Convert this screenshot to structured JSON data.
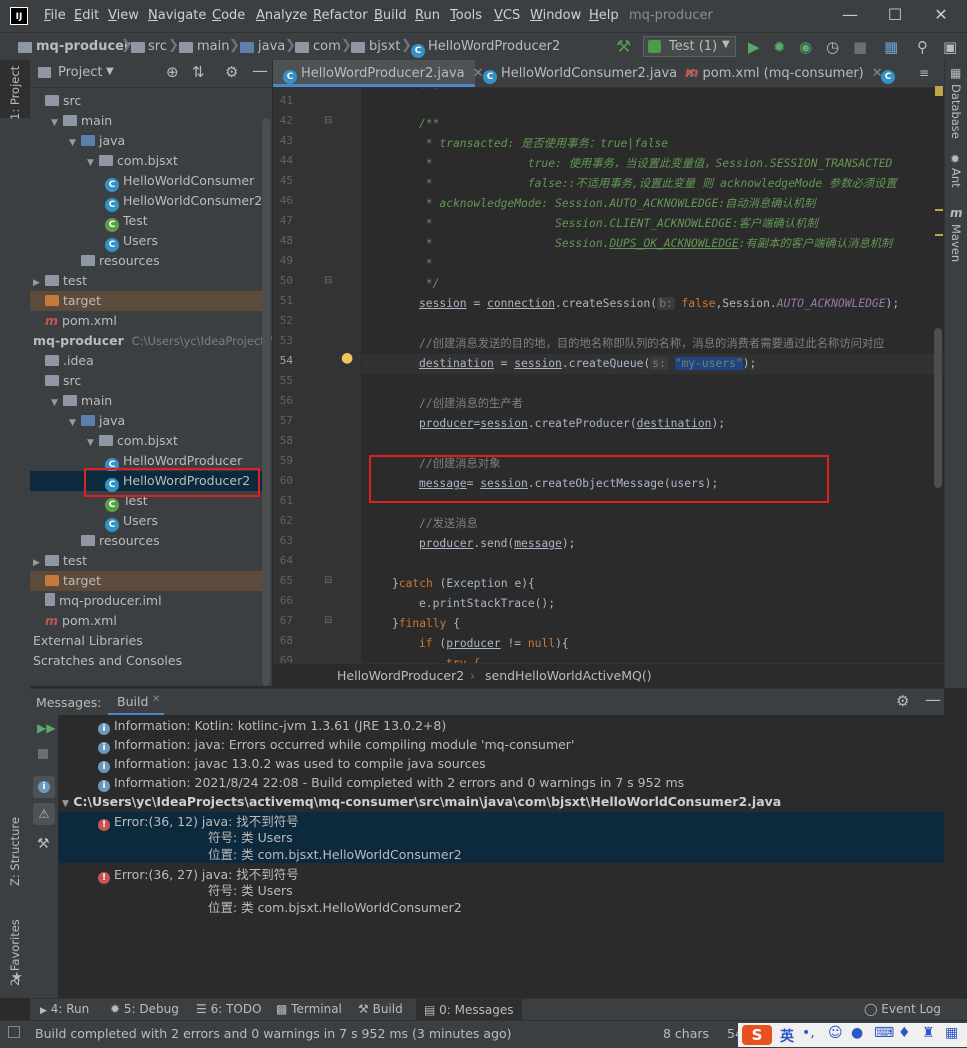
{
  "app": {
    "title": "mq-producer",
    "menu": [
      "File",
      "Edit",
      "View",
      "Navigate",
      "Code",
      "Analyze",
      "Refactor",
      "Build",
      "Run",
      "Tools",
      "VCS",
      "Window",
      "Help"
    ]
  },
  "nav": {
    "crumbs": [
      "mq-producer",
      "src",
      "main",
      "java",
      "com",
      "bjsxt",
      "HelloWordProducer2"
    ],
    "run_config": "Test (1)"
  },
  "left_stripe": {
    "project_tab": "1: Project",
    "structure_tab": "Z: Structure",
    "favorites_tab": "2: Favorites"
  },
  "project_panel": {
    "title": "Project",
    "tree": [
      {
        "label": "src",
        "kind": "folder",
        "indent": 0,
        "arrow": "none"
      },
      {
        "label": "main",
        "kind": "folder",
        "indent": 1,
        "arrow": "open"
      },
      {
        "label": "java",
        "kind": "folder-blue",
        "indent": 2,
        "arrow": "open"
      },
      {
        "label": "com.bjsxt",
        "kind": "folder",
        "indent": 3,
        "arrow": "open"
      },
      {
        "label": "HelloWorldConsumer",
        "kind": "class",
        "indent": 4,
        "arrow": "none"
      },
      {
        "label": "HelloWorldConsumer2",
        "kind": "class",
        "indent": 4,
        "arrow": "none"
      },
      {
        "label": "Test",
        "kind": "test",
        "indent": 4,
        "arrow": "none"
      },
      {
        "label": "Users",
        "kind": "class",
        "indent": 4,
        "arrow": "none"
      },
      {
        "label": "resources",
        "kind": "folder",
        "indent": 2,
        "arrow": "none"
      },
      {
        "label": "test",
        "kind": "folder",
        "indent": 0,
        "arrow": "closed"
      },
      {
        "label": "target",
        "kind": "folder-orange",
        "indent": 0,
        "arrow": "none"
      },
      {
        "label": "pom.xml",
        "kind": "maven",
        "indent": 0,
        "arrow": "none"
      },
      {
        "label": "mq-producer",
        "kind": "module",
        "indent": -1,
        "arrow": "none",
        "path": "C:\\Users\\yc\\IdeaProjects\\a"
      },
      {
        "label": ".idea",
        "kind": "folder",
        "indent": 0,
        "arrow": "none"
      },
      {
        "label": "src",
        "kind": "folder",
        "indent": 0,
        "arrow": "none"
      },
      {
        "label": "main",
        "kind": "folder",
        "indent": 1,
        "arrow": "open"
      },
      {
        "label": "java",
        "kind": "folder-blue",
        "indent": 2,
        "arrow": "open"
      },
      {
        "label": "com.bjsxt",
        "kind": "folder",
        "indent": 3,
        "arrow": "open"
      },
      {
        "label": "HelloWordProducer",
        "kind": "class",
        "indent": 4,
        "arrow": "none"
      },
      {
        "label": "HelloWordProducer2",
        "kind": "class",
        "indent": 4,
        "arrow": "none",
        "selected": true
      },
      {
        "label": "Test",
        "kind": "test",
        "indent": 4,
        "arrow": "none"
      },
      {
        "label": "Users",
        "kind": "class",
        "indent": 4,
        "arrow": "none"
      },
      {
        "label": "resources",
        "kind": "folder",
        "indent": 2,
        "arrow": "none"
      },
      {
        "label": "test",
        "kind": "folder",
        "indent": 0,
        "arrow": "closed"
      },
      {
        "label": "target",
        "kind": "folder-orange",
        "indent": 0,
        "arrow": "none"
      },
      {
        "label": "mq-producer.iml",
        "kind": "file",
        "indent": 0,
        "arrow": "none"
      },
      {
        "label": "pom.xml",
        "kind": "maven",
        "indent": 0,
        "arrow": "none"
      },
      {
        "label": "External Libraries",
        "kind": "plain",
        "indent": -1,
        "arrow": "none"
      },
      {
        "label": "Scratches and Consoles",
        "kind": "plain",
        "indent": -1,
        "arrow": "none"
      }
    ]
  },
  "editor": {
    "tabs": [
      "HelloWordProducer2.java",
      "HelloWorldConsumer2.java",
      "pom.xml (mq-consumer)"
    ],
    "line_numbers": [
      "41",
      "42",
      "43",
      "44",
      "45",
      "46",
      "47",
      "48",
      "49",
      "50",
      "51",
      "52",
      "53",
      "54",
      "55",
      "56",
      "57",
      "58",
      "59",
      "60",
      "61",
      "62",
      "63",
      "64",
      "65",
      "66",
      "67",
      "68",
      "69"
    ],
    "lines": {
      "l42": "/**",
      "l43": " * transacted: 是否使用事务：true|false",
      "l44": " *              true: 使用事务，当设置此变量值，Session.SESSION_TRANSACTED",
      "l45": " *              false::不适用事务,设置此变量 则 acknowledgeMode 参数必须设置",
      "l46": " * acknowledgeMode: Session.AUTO_ACKNOWLEDGE:自动消息确认机制",
      "l47": " *                  Session.CLIENT_ACKNOWLEDGE:客户端确认机制",
      "l48_a": " *                  Session.",
      "l48_b": "DUPS_OK_ACKNOWLEDGE",
      "l48_c": ":有副本的客户端确认消息机制",
      "l49": " *",
      "l50": " */",
      "l51_a": "session",
      "l51_b": " = ",
      "l51_c": "connection",
      "l51_d": ".createSession(",
      "l51_hint": "b:",
      "l51_e": "false",
      "l51_f": ",Session.",
      "l51_g": "AUTO_ACKNOWLEDGE",
      "l51_h": ");",
      "l53": "//创建消息发送的目的地，目的地名称即队列的名称，消息的消费者需要通过此名称访问对应",
      "l54_a": "destination",
      "l54_b": " = ",
      "l54_c": "session",
      "l54_d": ".createQueue(",
      "l54_hint": "s:",
      "l54_e": "\"my-users\"",
      "l54_f": ");",
      "l56": "//创建消息的生产者",
      "l57_a": "producer",
      "l57_b": "=",
      "l57_c": "session",
      "l57_d": ".createProducer(",
      "l57_e": "destination",
      "l57_f": ");",
      "l59": "//创建消息对象",
      "l60_a": "message",
      "l60_b": "= ",
      "l60_c": "session",
      "l60_d": ".createObjectMessage(users);",
      "l62": "//发送消息",
      "l63_a": "producer",
      "l63_b": ".send(",
      "l63_c": "message",
      "l63_d": ");",
      "l65_a": "}",
      "l65_b": "catch",
      "l65_c": " (Exception e){",
      "l66": "e.printStackTrace();",
      "l67_a": "}",
      "l67_b": "finally",
      "l67_c": " {",
      "l68_a": "if",
      "l68_b": " (",
      "l68_c": "producer",
      "l68_d": " != ",
      "l68_e": "null",
      "l68_f": "){",
      "l69": "try {"
    },
    "breadcrumb": [
      "HelloWordProducer2",
      "sendHelloWorldActiveMQ()"
    ]
  },
  "right_stripe": [
    "Database",
    "Ant",
    "Maven"
  ],
  "messages": {
    "label": "Messages:",
    "tab": "Build",
    "info": [
      "Information: Kotlin: kotlinc-jvm 1.3.61 (JRE 13.0.2+8)",
      "Information: java: Errors occurred while compiling module 'mq-consumer'",
      "Information: javac 13.0.2 was used to compile java sources",
      "Information: 2021/8/24 22:08 - Build completed with 2 errors and 0 warnings in 7 s 952 ms"
    ],
    "file_path": "C:\\Users\\yc\\IdeaProjects\\activemq\\mq-consumer\\src\\main\\java\\com\\bjsxt\\HelloWorldConsumer2.java",
    "errors": [
      {
        "head": "Error:(36, 12)  java: 找不到符号",
        "symbol": "符号:   类 Users",
        "location": "位置: 类 com.bjsxt.HelloWorldConsumer2"
      },
      {
        "head": "Error:(36, 27)  java: 找不到符号",
        "symbol": "符号:   类 Users",
        "location": "位置: 类 com.bjsxt.HelloWorldConsumer2"
      }
    ]
  },
  "bottom_tabs": [
    "4: Run",
    "5: Debug",
    "6: TODO",
    "Terminal",
    "Build",
    "0: Messages"
  ],
  "event_log": "Event Log",
  "status": {
    "text": "Build completed with 2 errors and 0 warnings in 7 s 952 ms (3 minutes ago)",
    "chars": "8 chars",
    "pos": "54:",
    "ime": "英"
  }
}
